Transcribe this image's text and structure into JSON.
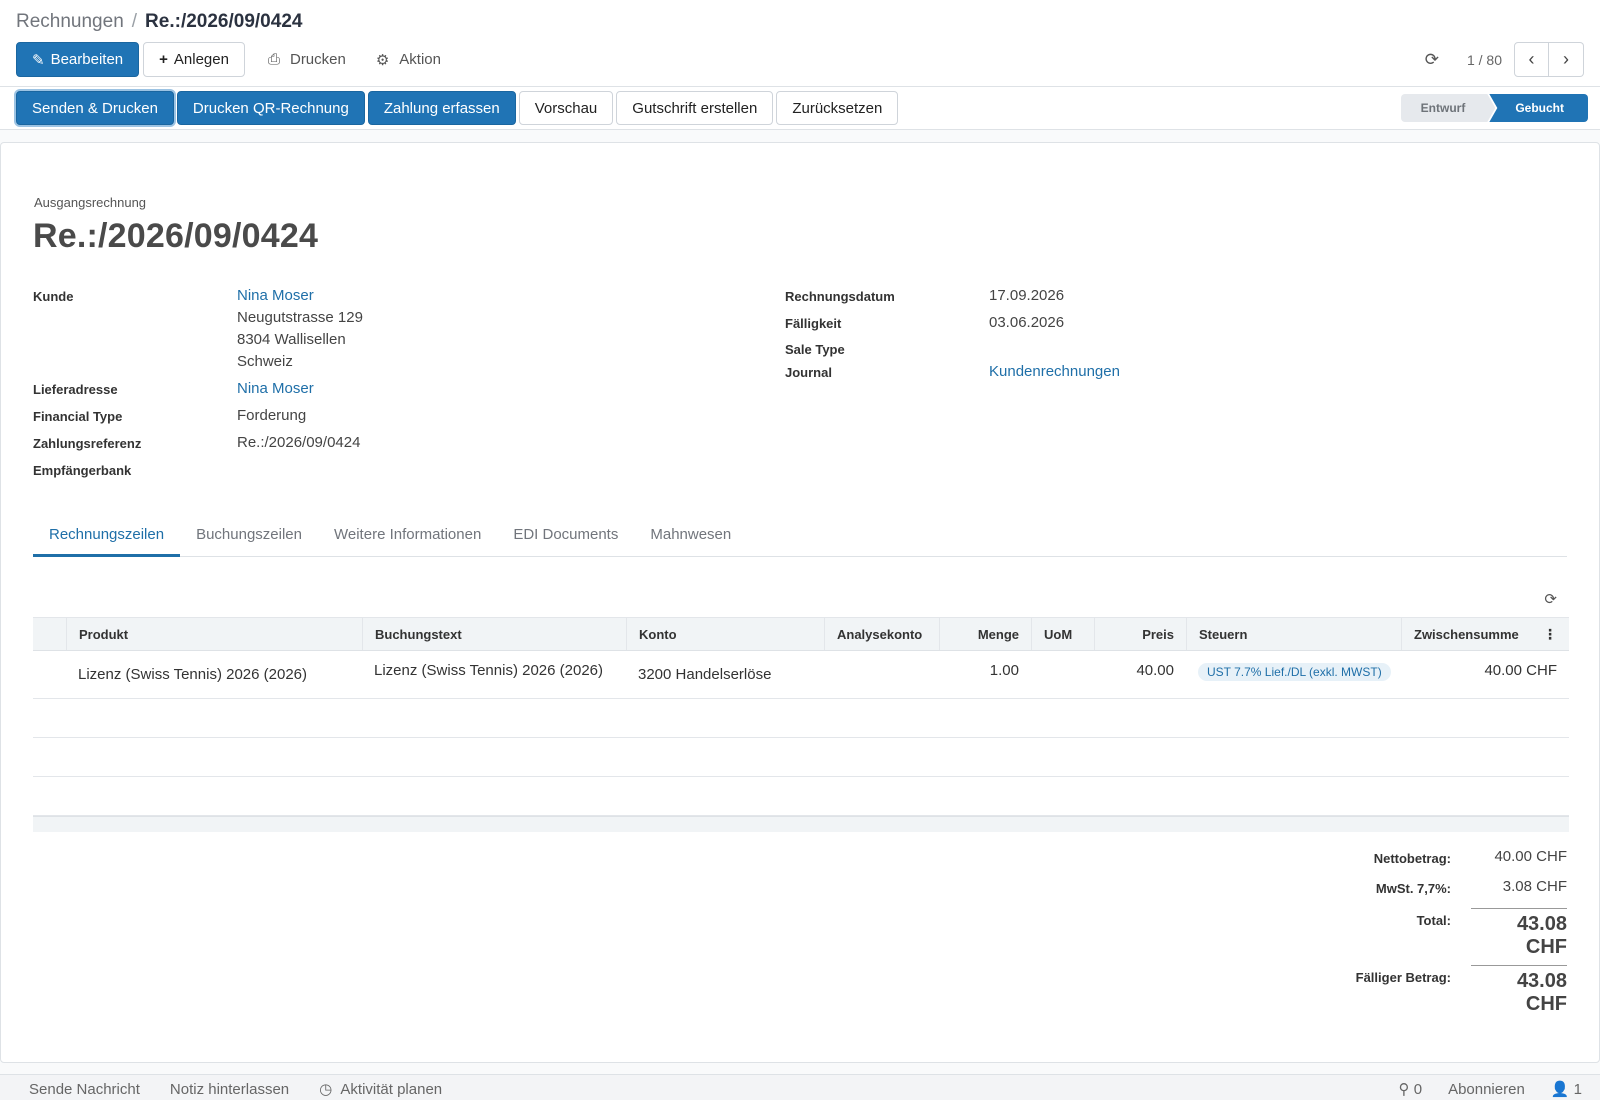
{
  "breadcrumb": {
    "parent": "Rechnungen",
    "separator": "/",
    "current": "Re.:/2026/09/0424"
  },
  "toolbar": {
    "edit": "Bearbeiten",
    "create": "Anlegen",
    "print": "Drucken",
    "action": "Aktion",
    "pager": "1 / 80"
  },
  "statusbar": {
    "buttons": [
      "Senden & Drucken",
      "Drucken QR-Rechnung",
      "Zahlung erfassen",
      "Vorschau",
      "Gutschrift erstellen",
      "Zurücksetzen"
    ],
    "stages": [
      "Entwurf",
      "Gebucht"
    ],
    "active_stage": "Gebucht"
  },
  "document": {
    "type": "Ausgangsrechnung",
    "title": "Re.:/2026/09/0424",
    "customer_label": "Kunde",
    "customer_name": "Nina Moser",
    "customer_street": "Neugutstrasse 129",
    "customer_city": "8304 Wallisellen",
    "customer_country": "Schweiz",
    "delivery_label": "Lieferadresse",
    "delivery_value": "Nina Moser",
    "financial_type_label": "Financial Type",
    "financial_type_value": "Forderung",
    "payment_ref_label": "Zahlungsreferenz",
    "payment_ref_value": "Re.:/2026/09/0424",
    "bank_label": "Empfängerbank",
    "invoice_date_label": "Rechnungsdatum",
    "invoice_date_value": "17.09.2026",
    "due_label": "Fälligkeit",
    "due_value": "03.06.2026",
    "sale_type_label": "Sale Type",
    "journal_label": "Journal",
    "journal_value": "Kundenrechnungen"
  },
  "tabs": [
    "Rechnungszeilen",
    "Buchungszeilen",
    "Weitere Informationen",
    "EDI Documents",
    "Mahnwesen"
  ],
  "lines": {
    "columns": [
      "Produkt",
      "Buchungstext",
      "Konto",
      "Analysekonto",
      "Menge",
      "UoM",
      "Preis",
      "Steuern",
      "Zwischensumme"
    ],
    "rows": [
      {
        "product": "Lizenz (Swiss Tennis) 2026 (2026)",
        "label": "Lizenz (Swiss Tennis) 2026 (2026)",
        "account": "3200 Handelserlöse",
        "analytic": "",
        "quantity": "1.00",
        "uom": "",
        "price": "40.00",
        "tax": "UST 7.7% Lief./DL (exkl. MWST)",
        "subtotal": "40.00 CHF"
      }
    ]
  },
  "totals": {
    "net_label": "Nettobetrag:",
    "net_value": "40.00 CHF",
    "tax_label": "MwSt. 7,7%:",
    "tax_value": "3.08 CHF",
    "total_label": "Total:",
    "total_value": "43.08 CHF",
    "due_label": "Fälliger Betrag:",
    "due_value": "43.08 CHF"
  },
  "chatter": {
    "send_message": "Sende Nachricht",
    "log_note": "Notiz hinterlassen",
    "schedule_activity": "Aktivität planen",
    "attachments": "0",
    "follow": "Abonnieren",
    "followers": "1"
  },
  "colors": {
    "primary": "#2074b5",
    "link": "#1f6fa8"
  }
}
